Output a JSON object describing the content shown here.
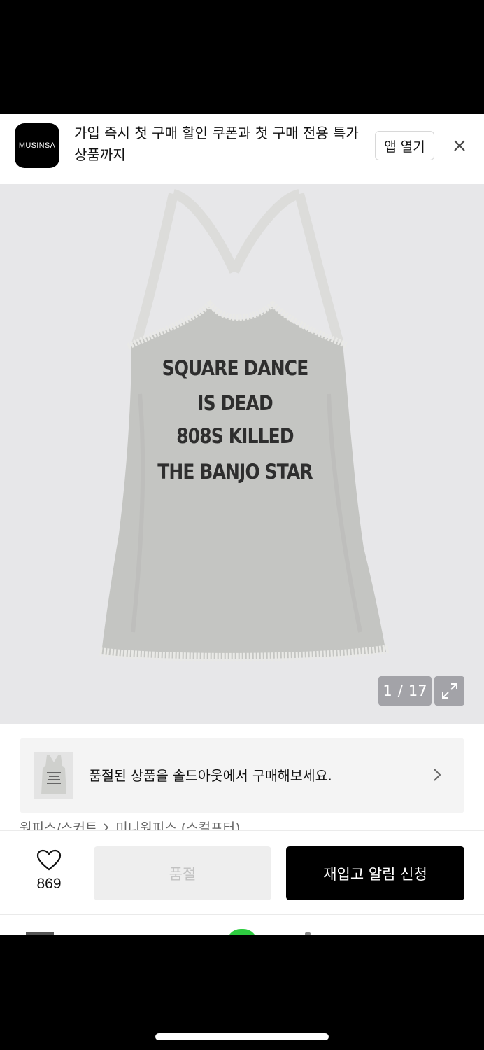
{
  "banner": {
    "logo_text": "MUSINSA",
    "message": "가입 즉시 첫 구매 할인 쿠폰과 첫 구매 전용 특가 상품까지",
    "open_app_label": "앱 열기",
    "close_icon": "close-icon"
  },
  "product_image": {
    "shirt_lines": [
      "SQUARE DANCE",
      "IS DEAD",
      "808S KILLED",
      "THE BANJO STAR"
    ],
    "counter_current": "1",
    "counter_separator": "/",
    "counter_total": "17",
    "expand_icon": "expand-icon"
  },
  "soldout_card": {
    "text": "품절된 상품을 솔드아웃에서 구매해보세요.",
    "thumb_icon": "product-thumbnail",
    "chevron_icon": "chevron-right-icon"
  },
  "breadcrumb": {
    "items": [
      "원피스/스커트",
      "미니원피스 (스컬프터)"
    ]
  },
  "bottom_bar": {
    "like_icon": "heart-icon",
    "like_count": "869",
    "soldout_label": "품절",
    "restock_label": "재입고 알림 신청"
  },
  "colors": {
    "accent_black": "#000000",
    "soldout_bg": "#eeeeee",
    "image_bg": "#e7e7e9"
  }
}
